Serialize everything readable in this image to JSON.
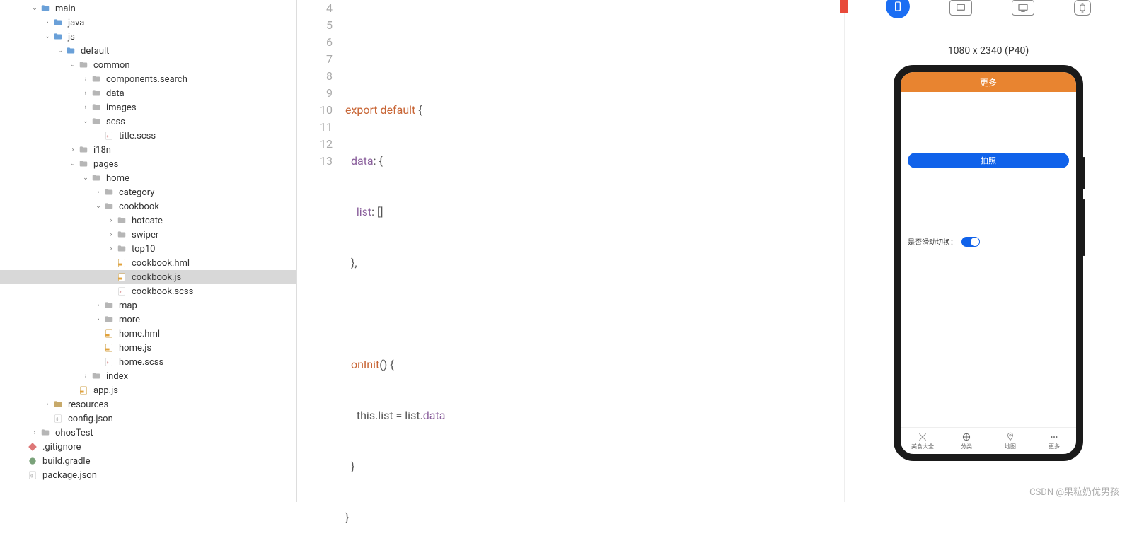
{
  "tree": [
    {
      "depth": 1,
      "arrow": "down",
      "icon": "folder",
      "label": "main"
    },
    {
      "depth": 2,
      "arrow": "right",
      "icon": "folder",
      "label": "java"
    },
    {
      "depth": 2,
      "arrow": "down",
      "icon": "folder",
      "label": "js"
    },
    {
      "depth": 3,
      "arrow": "down",
      "icon": "folder",
      "label": "default"
    },
    {
      "depth": 4,
      "arrow": "down",
      "icon": "folder-g",
      "label": "common"
    },
    {
      "depth": 5,
      "arrow": "right",
      "icon": "folder-g",
      "label": "components.search"
    },
    {
      "depth": 5,
      "arrow": "right",
      "icon": "folder-g",
      "label": "data"
    },
    {
      "depth": 5,
      "arrow": "right",
      "icon": "folder-g",
      "label": "images"
    },
    {
      "depth": 5,
      "arrow": "down",
      "icon": "folder-g",
      "label": "scss"
    },
    {
      "depth": 6,
      "arrow": "none",
      "icon": "scss",
      "label": "title.scss"
    },
    {
      "depth": 4,
      "arrow": "right",
      "icon": "folder-g",
      "label": "i18n"
    },
    {
      "depth": 4,
      "arrow": "down",
      "icon": "folder-g",
      "label": "pages"
    },
    {
      "depth": 5,
      "arrow": "down",
      "icon": "folder-g",
      "label": "home"
    },
    {
      "depth": 6,
      "arrow": "right",
      "icon": "folder-g",
      "label": "category"
    },
    {
      "depth": 6,
      "arrow": "down",
      "icon": "folder-g",
      "label": "cookbook"
    },
    {
      "depth": 7,
      "arrow": "right",
      "icon": "folder-g",
      "label": "hotcate"
    },
    {
      "depth": 7,
      "arrow": "right",
      "icon": "folder-g",
      "label": "swiper"
    },
    {
      "depth": 7,
      "arrow": "right",
      "icon": "folder-g",
      "label": "top10"
    },
    {
      "depth": 7,
      "arrow": "none",
      "icon": "hml",
      "label": "cookbook.hml"
    },
    {
      "depth": 7,
      "arrow": "none",
      "icon": "js",
      "label": "cookbook.js",
      "selected": true
    },
    {
      "depth": 7,
      "arrow": "none",
      "icon": "scss",
      "label": "cookbook.scss"
    },
    {
      "depth": 6,
      "arrow": "right",
      "icon": "folder-g",
      "label": "map"
    },
    {
      "depth": 6,
      "arrow": "right",
      "icon": "folder-g",
      "label": "more"
    },
    {
      "depth": 6,
      "arrow": "none",
      "icon": "hml",
      "label": "home.hml"
    },
    {
      "depth": 6,
      "arrow": "none",
      "icon": "js",
      "label": "home.js"
    },
    {
      "depth": 6,
      "arrow": "none",
      "icon": "scss",
      "label": "home.scss"
    },
    {
      "depth": 5,
      "arrow": "right",
      "icon": "folder-g",
      "label": "index"
    },
    {
      "depth": 4,
      "arrow": "none",
      "icon": "js",
      "label": "app.js"
    },
    {
      "depth": 2,
      "arrow": "right",
      "icon": "folder-y",
      "label": "resources"
    },
    {
      "depth": 2,
      "arrow": "none",
      "icon": "json",
      "label": "config.json"
    },
    {
      "depth": 1,
      "arrow": "right",
      "icon": "folder-g",
      "label": "ohosTest"
    },
    {
      "depth": 0,
      "arrow": "none",
      "icon": "git",
      "label": ".gitignore"
    },
    {
      "depth": 0,
      "arrow": "none",
      "icon": "gradle",
      "label": "build.gradle"
    },
    {
      "depth": 0,
      "arrow": "none",
      "icon": "json",
      "label": "package.json"
    }
  ],
  "gutter": [
    "4",
    "5",
    "6",
    "7",
    "8",
    "9",
    "10",
    "11",
    "12",
    "13"
  ],
  "code": {
    "l5": {
      "kw1": "export",
      "kw2": "default",
      "brace": " {"
    },
    "l6": {
      "k": "data",
      "rest": ": {"
    },
    "l7": {
      "k": "list",
      "rest": ": []"
    },
    "l8": {
      "rest": "},"
    },
    "l10": {
      "fn": "onInit",
      "rest": "() {"
    },
    "l11": {
      "this": "this",
      "rest1": ".list = list.",
      "data": "data"
    },
    "l12": {
      "rest": "}"
    },
    "l13": {
      "rest": "}"
    }
  },
  "preview": {
    "dims": "1080 x 2340 (P40)",
    "header": "更多",
    "photo_btn": "拍照",
    "switch_label": "是否滑动切换：",
    "nav": [
      "美食大全",
      "分类",
      "地图",
      "更多"
    ]
  },
  "watermark": "CSDN @果粒奶优男孩"
}
